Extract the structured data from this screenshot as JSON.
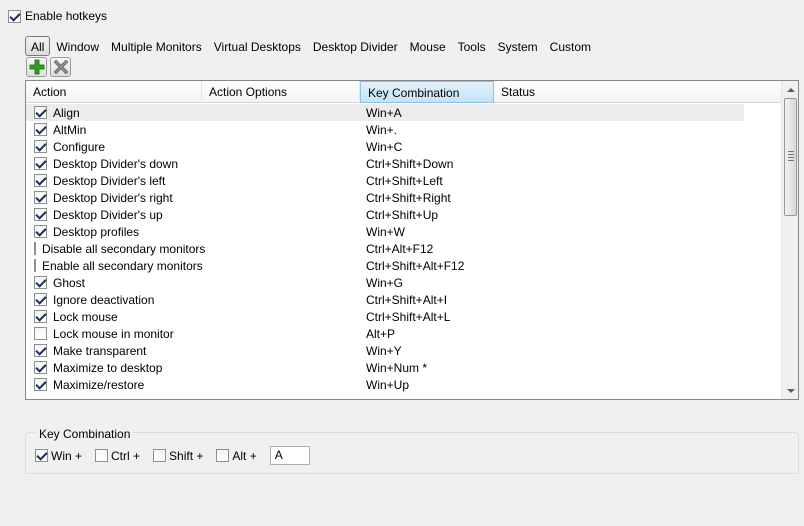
{
  "enable_hotkeys": {
    "label": "Enable hotkeys",
    "checked": true
  },
  "tabs": [
    {
      "label": "All",
      "active": true
    },
    {
      "label": "Window"
    },
    {
      "label": "Multiple Monitors"
    },
    {
      "label": "Virtual Desktops"
    },
    {
      "label": "Desktop Divider"
    },
    {
      "label": "Mouse"
    },
    {
      "label": "Tools"
    },
    {
      "label": "System"
    },
    {
      "label": "Custom"
    }
  ],
  "toolbar": {
    "add_icon": "plus-icon",
    "remove_icon": "x-icon",
    "add_color": "#2e9e1e",
    "remove_color": "#8a8a8a"
  },
  "list": {
    "columns": [
      "Action",
      "Action Options",
      "Key Combination",
      "Status"
    ],
    "rows": [
      {
        "checked": true,
        "action": "Align",
        "options": "",
        "key": "Win+A",
        "status": ""
      },
      {
        "checked": true,
        "action": "AltMin",
        "options": "",
        "key": "Win+.",
        "status": ""
      },
      {
        "checked": true,
        "action": "Configure",
        "options": "",
        "key": "Win+C",
        "status": ""
      },
      {
        "checked": true,
        "action": "Desktop Divider's down",
        "options": "",
        "key": "Ctrl+Shift+Down",
        "status": ""
      },
      {
        "checked": true,
        "action": "Desktop Divider's left",
        "options": "",
        "key": "Ctrl+Shift+Left",
        "status": ""
      },
      {
        "checked": true,
        "action": "Desktop Divider's right",
        "options": "",
        "key": "Ctrl+Shift+Right",
        "status": ""
      },
      {
        "checked": true,
        "action": "Desktop Divider's up",
        "options": "",
        "key": "Ctrl+Shift+Up",
        "status": ""
      },
      {
        "checked": true,
        "action": "Desktop profiles",
        "options": "",
        "key": "Win+W",
        "status": ""
      },
      {
        "checked": false,
        "action": "Disable all secondary monitors",
        "options": "",
        "key": "Ctrl+Alt+F12",
        "status": ""
      },
      {
        "checked": false,
        "action": "Enable all secondary monitors",
        "options": "",
        "key": "Ctrl+Shift+Alt+F12",
        "status": ""
      },
      {
        "checked": true,
        "action": "Ghost",
        "options": "",
        "key": "Win+G",
        "status": ""
      },
      {
        "checked": true,
        "action": "Ignore deactivation",
        "options": "",
        "key": "Ctrl+Shift+Alt+I",
        "status": ""
      },
      {
        "checked": true,
        "action": "Lock mouse",
        "options": "",
        "key": "Ctrl+Shift+Alt+L",
        "status": ""
      },
      {
        "checked": false,
        "action": "Lock mouse in monitor",
        "options": "",
        "key": "Alt+P",
        "status": ""
      },
      {
        "checked": true,
        "action": "Make transparent",
        "options": "",
        "key": "Win+Y",
        "status": ""
      },
      {
        "checked": true,
        "action": "Maximize to desktop",
        "options": "",
        "key": "Win+Num *",
        "status": ""
      },
      {
        "checked": true,
        "action": "Maximize/restore",
        "options": "",
        "key": "Win+Up",
        "status": ""
      }
    ]
  },
  "key_combination": {
    "title": "Key Combination",
    "modifiers": [
      {
        "label": "Win +",
        "checked": true
      },
      {
        "label": "Ctrl +",
        "checked": false
      },
      {
        "label": "Shift +",
        "checked": false
      },
      {
        "label": "Alt +",
        "checked": false
      }
    ],
    "key_value": "A"
  }
}
